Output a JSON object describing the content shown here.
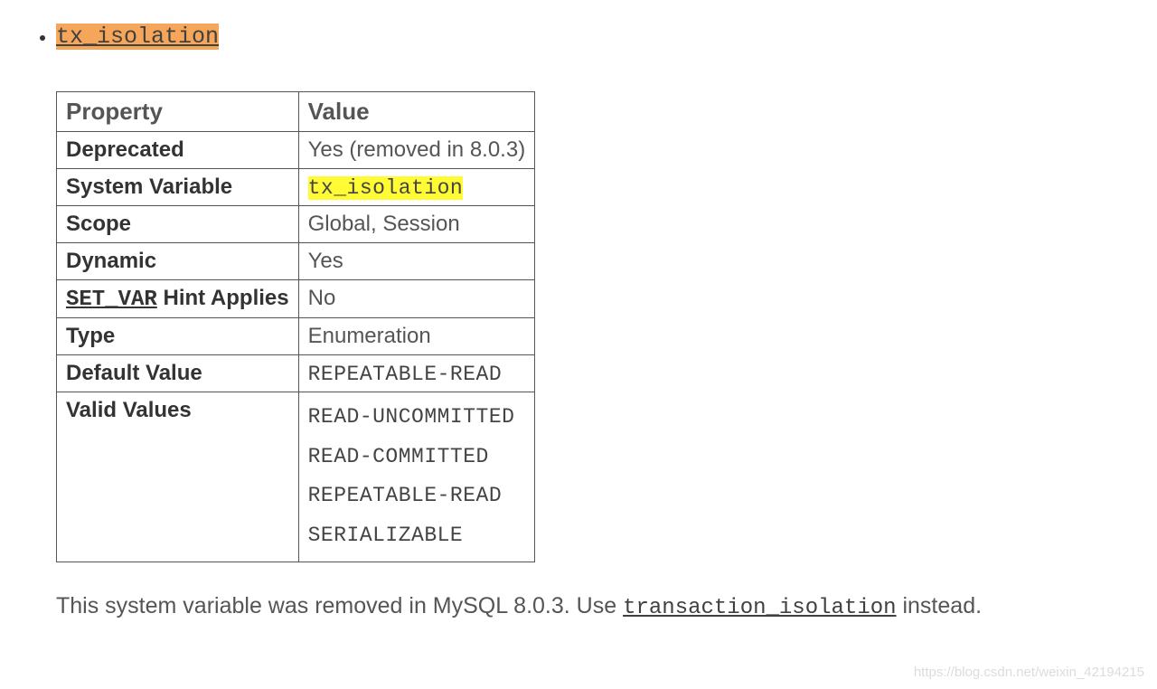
{
  "heading_link": "tx_isolation",
  "table": {
    "header_property": "Property",
    "header_value": "Value",
    "rows": {
      "deprecated": {
        "label": "Deprecated",
        "value": "Yes (removed in 8.0.3)"
      },
      "system_variable": {
        "label": "System Variable",
        "value": "tx_isolation"
      },
      "scope": {
        "label": "Scope",
        "value": "Global, Session"
      },
      "dynamic": {
        "label": "Dynamic",
        "value": "Yes"
      },
      "set_var": {
        "link": "SET_VAR",
        "label_suffix": " Hint Applies",
        "value": "No"
      },
      "type": {
        "label": "Type",
        "value": "Enumeration"
      },
      "default_value": {
        "label": "Default Value",
        "value": "REPEATABLE-READ"
      },
      "valid_values": {
        "label": "Valid Values",
        "values": [
          "READ-UNCOMMITTED",
          "READ-COMMITTED",
          "REPEATABLE-READ",
          "SERIALIZABLE"
        ]
      }
    }
  },
  "note": {
    "pre": "This system variable was removed in MySQL 8.0.3. Use ",
    "link": "transaction_isolation",
    "post": " instead."
  },
  "watermark": "https://blog.csdn.net/weixin_42194215"
}
